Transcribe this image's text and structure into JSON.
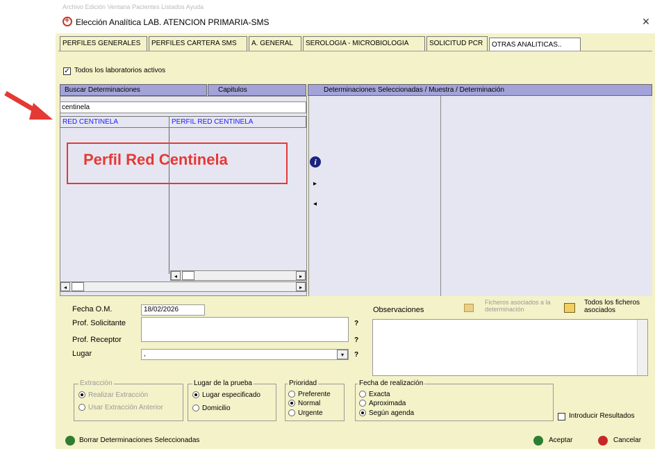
{
  "window": {
    "top_strip": "Archivo  Edición  Ventana  Pacientes  Listados  Ayuda",
    "title": "Elección Analítica LAB. ATENCION PRIMARIA-SMS",
    "close_symbol": "×"
  },
  "tabs": [
    {
      "label": "PERFILES GENERALES"
    },
    {
      "label": "PERFILES CARTERA SMS"
    },
    {
      "label": "A. GENERAL"
    },
    {
      "label": "SEROLOGIA - MICROBIOLOGIA"
    },
    {
      "label": "SOLICITUD PCR"
    },
    {
      "label": "OTRAS ANALITICAS.."
    }
  ],
  "all_labs": {
    "label": "Todos los laboratorios activos",
    "checked": true
  },
  "search": {
    "tab_buscar": "Buscar Determinaciones",
    "tab_capitulos": "Capitulos",
    "selected_header": "Determinaciones Seleccionadas / Muestra / Determinación",
    "query": "centinela",
    "results": [
      {
        "code": "RED CENTINELA",
        "name": "PERFIL RED CENTINELA"
      }
    ]
  },
  "annotation": {
    "callout": "Perfil Red Centinela",
    "color": "#e53935"
  },
  "transfer": {
    "info_icon": "info-icon",
    "move_right": "▸",
    "move_left": "◂"
  },
  "form": {
    "fecha_label": "Fecha O.M.",
    "fecha_value": "18/02/2026",
    "prof_solicitante_label": "Prof. Solicitante",
    "prof_receptor_label": "Prof. Receptor",
    "lugar_label": "Lugar",
    "lugar_value": ",",
    "q": "?",
    "observaciones_label": "Observaciones",
    "ficheros_det_label": "Ficheros asociados a la determinación",
    "todos_ficheros_label": "Todos los ficheros asociados"
  },
  "extraccion": {
    "legend": "Extracción",
    "options": [
      "Realizar Extracción",
      "Usar Extracción Anterior"
    ],
    "selected": 0
  },
  "lugar_prueba": {
    "legend": "Lugar de la prueba",
    "options": [
      "Lugar especificado",
      "Domicilio"
    ],
    "selected": 0
  },
  "prioridad": {
    "legend": "Prioridad",
    "options": [
      "Preferente",
      "Normal",
      "Urgente"
    ],
    "selected": 1
  },
  "fecha_realizacion": {
    "legend": "Fecha de realización",
    "options": [
      "Exacta",
      "Aproximada",
      "Según agenda"
    ],
    "selected": 2
  },
  "introducir": {
    "label": "Introducir Resultados",
    "checked": false
  },
  "footer": {
    "borrar": "Borrar Determinaciones Seleccionadas",
    "aceptar": "Aceptar",
    "cancelar": "Cancelar"
  }
}
